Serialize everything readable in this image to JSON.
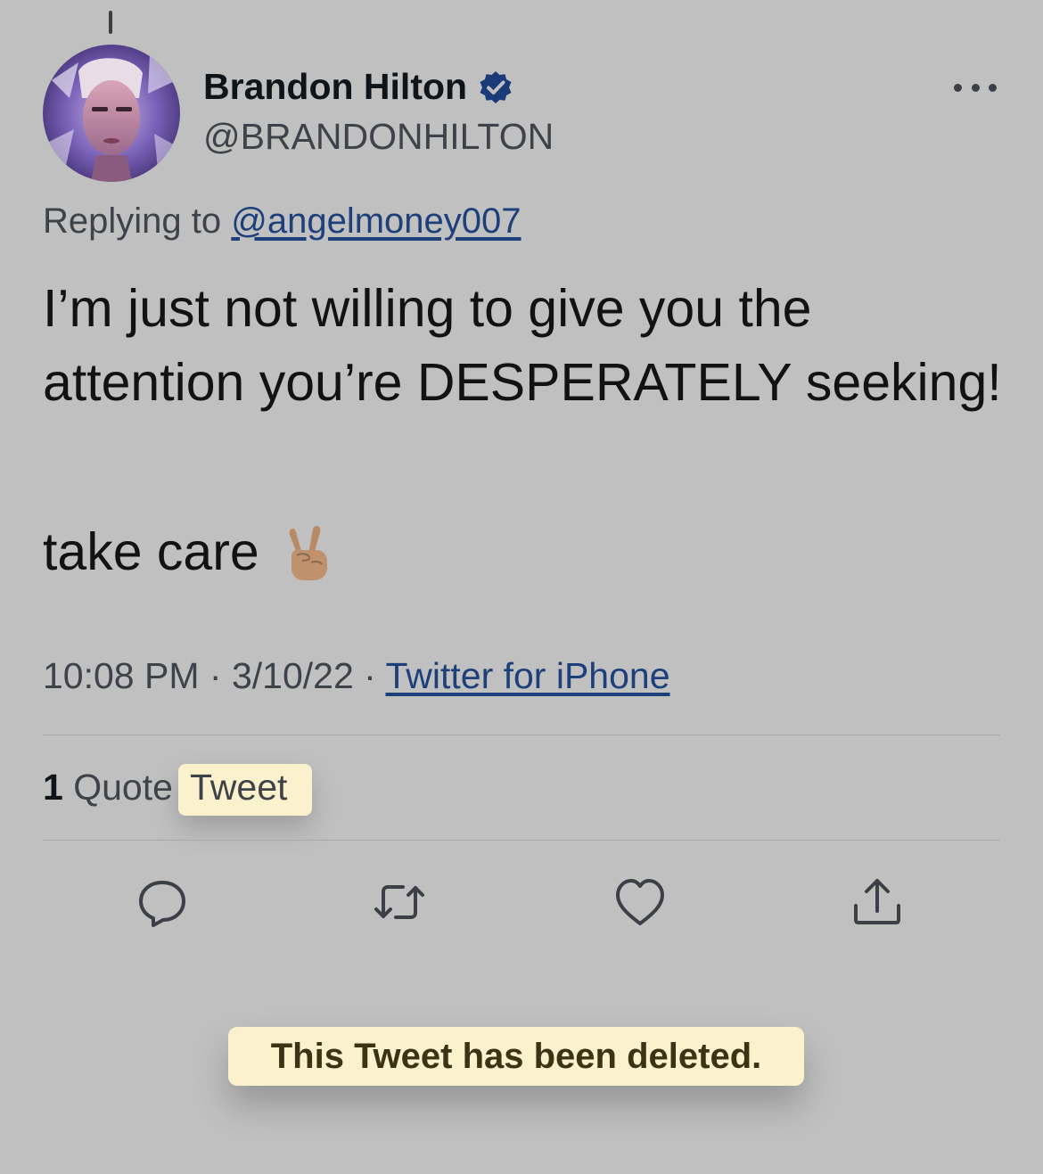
{
  "author": {
    "display_name": "Brandon Hilton",
    "handle": "@BRANDONHILTON",
    "verified": true
  },
  "reply": {
    "prefix": "Replying to",
    "to_handle": "@angelmoney007"
  },
  "tweet": {
    "paragraph1": "I’m just not willing to give you the attention you’re DESPERATELY seeking!",
    "paragraph2": "take care",
    "emoji": "✌🏽"
  },
  "meta": {
    "time": "10:08 PM",
    "separator": "·",
    "date": "3/10/22",
    "source": "Twitter for iPhone"
  },
  "stats": {
    "quote_count": "1",
    "quote_word": "Quote",
    "tweet_word": "Tweet"
  },
  "toast": {
    "message": "This Tweet has been deleted."
  },
  "colors": {
    "background": "#c0c0c0",
    "link": "#1d3f7a",
    "verified_badge": "#1a3a78",
    "toast_bg": "#fbf2cd"
  },
  "icons": [
    "reply-icon",
    "retweet-icon",
    "like-icon",
    "share-icon",
    "more-icon",
    "verified-icon"
  ]
}
